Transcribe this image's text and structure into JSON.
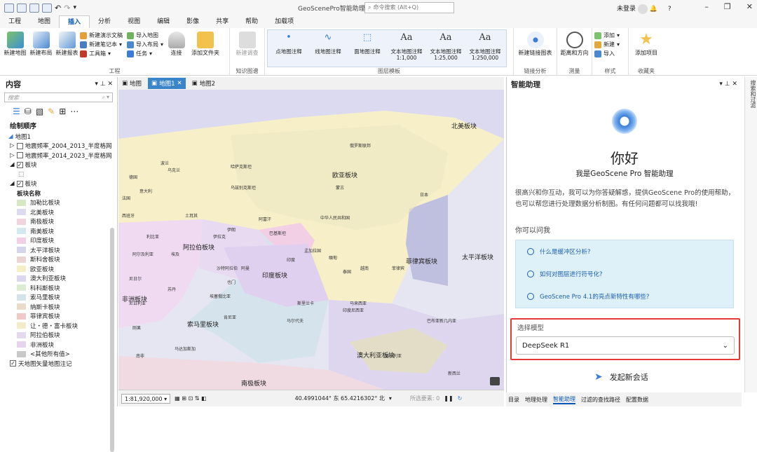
{
  "titlebar": {
    "title": "GeoScenePro智能助理",
    "search_placeholder": "命令搜索 (Alt+Q)",
    "user": "未登录",
    "help": "?"
  },
  "tabs": [
    "工程",
    "地图",
    "插入",
    "分析",
    "视图",
    "编辑",
    "影像",
    "共享",
    "帮助",
    "加载项"
  ],
  "active_tab": "插入",
  "ribbon": {
    "project": {
      "label": "工程",
      "new_map": "新建地图",
      "new_layout": "新建布局",
      "new_report": "新建报表",
      "new_pres": "新建演示文稿",
      "new_notebook": "新建笔记本",
      "toolbox": "工具箱",
      "import_map": "导入地图",
      "import_layout": "导入布局",
      "task": "任务",
      "connect": "连接",
      "add_folder": "添加文件夹"
    },
    "knowledge": {
      "label": "知识图谱",
      "new_survey": "新建调查"
    },
    "gallery": {
      "label": "图层模板",
      "items": [
        {
          "title": "点地图注释",
          "sub": ""
        },
        {
          "title": "线地图注释",
          "sub": ""
        },
        {
          "title": "面地图注释",
          "sub": ""
        },
        {
          "title": "文本地图注释",
          "sub": "1:1,000"
        },
        {
          "title": "文本地图注释",
          "sub": "1:25,000"
        },
        {
          "title": "文本地图注释",
          "sub": "1:250,000"
        }
      ]
    },
    "link": {
      "label": "链接分析",
      "new_chart": "新建链接图表"
    },
    "measure": {
      "label": "测量",
      "distance": "距离和方向"
    },
    "style": {
      "label": "样式",
      "add": "添加",
      "new": "新建",
      "import": "导入"
    },
    "favorites": {
      "label": "收藏夹",
      "add_item": "添加项目"
    }
  },
  "contents": {
    "title": "内容",
    "search_placeholder": "搜索",
    "draw_order": "绘制顺序",
    "map_name": "地图1",
    "layers": [
      {
        "name": "地震频率_2004_2013_半度格网",
        "checked": false
      },
      {
        "name": "地震频率_2014_2023_半度格网",
        "checked": false
      },
      {
        "name": "板块",
        "checked": true
      },
      {
        "name": "板块",
        "checked": true
      }
    ],
    "field": "板块名称",
    "legend": [
      {
        "name": "加勒比板块",
        "color": "#d9e8c4"
      },
      {
        "name": "北美板块",
        "color": "#dcdaf0"
      },
      {
        "name": "南极板块",
        "color": "#f2d4de"
      },
      {
        "name": "南美板块",
        "color": "#d2e9ef"
      },
      {
        "name": "印度板块",
        "color": "#f3cfe6"
      },
      {
        "name": "太平洋板块",
        "color": "#d6d6ea"
      },
      {
        "name": "斯科舍板块",
        "color": "#ebd5d0"
      },
      {
        "name": "欧亚板块",
        "color": "#f5efc6"
      },
      {
        "name": "澳大利亚板块",
        "color": "#dcd6ee"
      },
      {
        "name": "科科斯板块",
        "color": "#dbedd0"
      },
      {
        "name": "索马里板块",
        "color": "#d3e3ea"
      },
      {
        "name": "纳斯卡板块",
        "color": "#e8dcc9"
      },
      {
        "name": "菲律宾板块",
        "color": "#f0c8c8"
      },
      {
        "name": "让・德・富卡板块",
        "color": "#f3ecc6"
      },
      {
        "name": "阿拉伯板块",
        "color": "#e5d9ef"
      },
      {
        "name": "非洲板块",
        "color": "#e6d3ec"
      },
      {
        "name": "<其他所有值>",
        "color": "#c8c8c8"
      }
    ],
    "basemap": "天地图矢量地图注记"
  },
  "doc_tabs": [
    {
      "label": "地图",
      "active": false
    },
    {
      "label": "地图1",
      "active": true
    },
    {
      "label": "地图2",
      "active": false
    }
  ],
  "map": {
    "plate_labels": [
      "北美板块",
      "欧亚板块",
      "阿拉伯板块",
      "印度板块",
      "非洲板块",
      "索马里板块",
      "菲律宾板块",
      "太平洋板块",
      "澳大利亚板块",
      "南极板块"
    ],
    "country_labels": [
      "俄罗斯联邦",
      "中华人民共和国",
      "蒙古",
      "印度",
      "伊朗",
      "阿富汗",
      "巴基斯坦",
      "沙特阿拉伯",
      "埃及",
      "苏丹",
      "埃塞俄比亚",
      "肯尼亚",
      "乌克兰",
      "德国",
      "法国",
      "西班牙",
      "意大利",
      "波兰",
      "哈萨克斯坦",
      "乌兹别克斯坦",
      "土耳其",
      "伊拉克",
      "也门",
      "阿曼",
      "利比亚",
      "阿尔及利亚",
      "尼日尔",
      "尼日利亚",
      "刚果",
      "南非",
      "马达加斯加",
      "日本",
      "泰国",
      "越南",
      "印度尼西亚",
      "澳大利亚",
      "巴布亚新几内亚",
      "新西兰",
      "斯里兰卡",
      "马尔代夫",
      "孟加拉国",
      "缅甸",
      "菲律宾",
      "马来西亚"
    ]
  },
  "status": {
    "scale": "1:81,920,000",
    "coords": "40.4991044° 东  65.4216302° 北",
    "selected": "所选要素: 0"
  },
  "assistant": {
    "title": "智能助理",
    "hello": "你好",
    "sub": "我是GeoScene Pro 智能助理",
    "desc": "很高兴和你互动，我可以为你答疑解惑，提供GeoScene Pro的使用帮助，也可以帮您进行处理数据分析制图。有任何问题都可以找我哦!",
    "ask": "你可以问我",
    "suggestions": [
      "什么是缓冲区分析?",
      "如何对图层进行符号化?",
      "GeoScene Pro 4.1的亮点新特性有哪些?"
    ],
    "model_label": "选择模型",
    "model": "DeepSeek R1",
    "send": "发起新会话"
  },
  "bottom_tabs": [
    "目录",
    "地理处理",
    "智能助理",
    "过滤的查找路径",
    "配置数据"
  ],
  "side_strip": "搜索和过滤"
}
